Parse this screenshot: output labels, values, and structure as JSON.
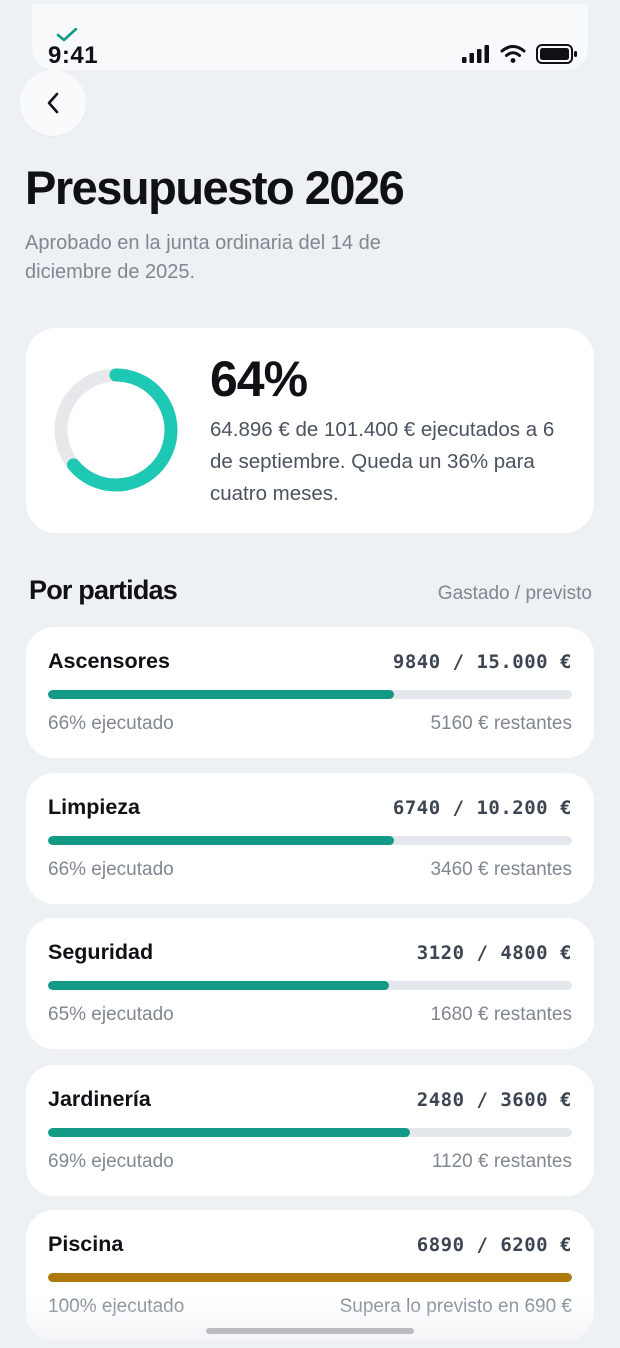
{
  "status": {
    "time": "9:41"
  },
  "header": {
    "title": "Presupuesto 2026",
    "subtitle": "Aprobado en la junta ordinaria del 14 de diciembre de 2025."
  },
  "summary": {
    "percent_label": "64%",
    "percent_value": 0.64,
    "description": "64.896 € de 101.400 € ejecutados a 6 de septiembre. Queda un 36% para cuatro meses.",
    "ring_color": "#1ec8b4",
    "track_color": "#e6e8eb"
  },
  "section": {
    "title": "Por partidas",
    "hint": "Gastado / previsto"
  },
  "items": [
    {
      "name": "Ascensores",
      "amount": "9840 / 15.000 €",
      "progress": 0.66,
      "pct_label": "66% ejecutado",
      "rest": "5160 € restantes",
      "color": "#129a86"
    },
    {
      "name": "Limpieza",
      "amount": "6740 / 10.200 €",
      "progress": 0.66,
      "pct_label": "66% ejecutado",
      "rest": "3460 € restantes",
      "color": "#129a86"
    },
    {
      "name": "Seguridad",
      "amount": "3120 / 4800 €",
      "progress": 0.65,
      "pct_label": "65% ejecutado",
      "rest": "1680 € restantes",
      "color": "#129a86"
    },
    {
      "name": "Jardinería",
      "amount": "2480 / 3600 €",
      "progress": 0.69,
      "pct_label": "69% ejecutado",
      "rest": "1120 € restantes",
      "color": "#129a86"
    },
    {
      "name": "Piscina",
      "amount": "6890 / 6200 €",
      "progress": 1.0,
      "pct_label": "100% ejecutado",
      "rest": "Supera lo previsto en 690 €",
      "color": "#ad7a0a"
    }
  ]
}
